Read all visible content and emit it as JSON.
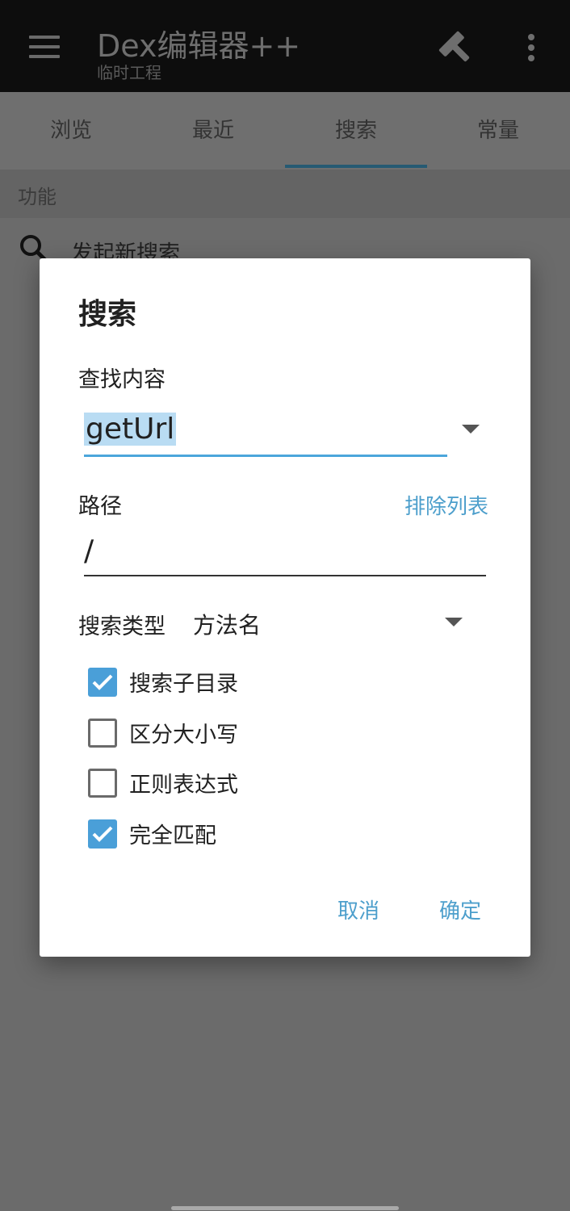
{
  "app": {
    "title": "Dex编辑器++",
    "subtitle": "临时工程",
    "icons": [
      "menu-icon",
      "hammer-icon",
      "more-vert-icon"
    ]
  },
  "tabs": [
    {
      "label": "浏览",
      "selected": false
    },
    {
      "label": "最近",
      "selected": false
    },
    {
      "label": "搜索",
      "selected": true
    },
    {
      "label": "常量",
      "selected": false
    }
  ],
  "section": {
    "header": "功能"
  },
  "list": {
    "item_label": "发起新搜索",
    "item_icon": "search-icon"
  },
  "dialog": {
    "title": "搜索",
    "find_label": "查找内容",
    "find_value": "getUrl",
    "path_label": "路径",
    "exclude_link": "排除列表",
    "path_value": "/",
    "type_label": "搜索类型",
    "type_value": "方法名",
    "checkboxes": [
      {
        "label": "搜索子目录",
        "checked": true
      },
      {
        "label": "区分大小写",
        "checked": false
      },
      {
        "label": "正则表达式",
        "checked": false
      },
      {
        "label": "完全匹配",
        "checked": true
      }
    ],
    "cancel_label": "取消",
    "ok_label": "确定"
  },
  "colors": {
    "accent": "#4d9fcc",
    "checkbox_on": "#4a9fd8",
    "input_underline": "#4ba6db"
  }
}
